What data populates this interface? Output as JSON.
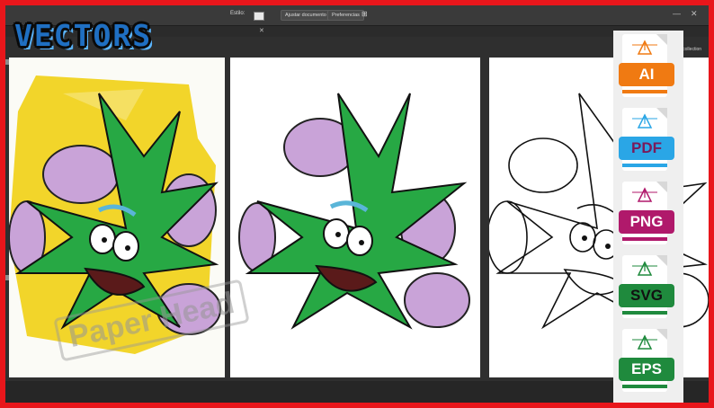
{
  "banner": {
    "title": "VECTORS",
    "watermark": "Paper Head"
  },
  "toolbar": {
    "style_label": "Estilo:",
    "adjust_document": "Ajustar documento",
    "preferences": "Preferencias"
  },
  "panel": {
    "library_label": "n collection"
  },
  "file_formats": [
    {
      "label": "AI",
      "color": "#f07a12"
    },
    {
      "label": "PDF",
      "color": "#2aa6e6"
    },
    {
      "label": "PNG",
      "color": "#b0196b"
    },
    {
      "label": "SVG",
      "color": "#1f8a3d"
    },
    {
      "label": "EPS",
      "color": "#1f8a3d"
    }
  ],
  "colors": {
    "frame_red": "#e8161b",
    "leaf_green": "#27a844",
    "smoke_purple": "#c9a3d8",
    "bg_yellow": "#f2d52a"
  }
}
